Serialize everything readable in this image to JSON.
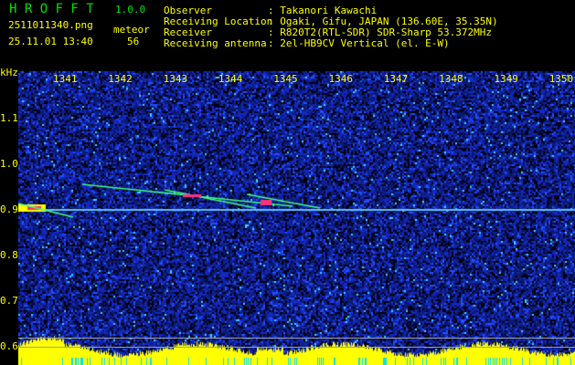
{
  "app": {
    "title_letters": "H R O F F T",
    "version": "1.0.0"
  },
  "file": {
    "name": "2511011340.png",
    "datetime": "25.11.01 13:40"
  },
  "detection": {
    "label": "meteor",
    "count": "56"
  },
  "info": [
    {
      "label": "Observer",
      "value": ": Takanori Kawachi"
    },
    {
      "label": "Receiving Location",
      "value": ": Ogaki, Gifu, JAPAN (136.60E, 35.35N)"
    },
    {
      "label": "Receiver",
      "value": ": R820T2(RTL-SDR) SDR-Sharp 53.372MHz"
    },
    {
      "label": "Receiving antenna",
      "value": ": 2el-HB9CV Vertical (el. E-W)"
    }
  ],
  "chart_data": {
    "type": "heatmap",
    "ylabel": "kHz",
    "y_ticks": [
      "1.1",
      "1.0",
      "0.9",
      "0.8",
      "0.7",
      "0.6"
    ],
    "ylim": [
      0.58,
      1.2
    ],
    "x_ticks": [
      "1341",
      "1342",
      "1343",
      "1344",
      "1345",
      "1346",
      "1347",
      "1348",
      "1349",
      "1350"
    ],
    "carrier_khz": 0.9
  },
  "colors": {
    "text": "#ffff00",
    "title": "#00e000",
    "bars": "#ffff00",
    "bars_low": "#00e0ff"
  }
}
